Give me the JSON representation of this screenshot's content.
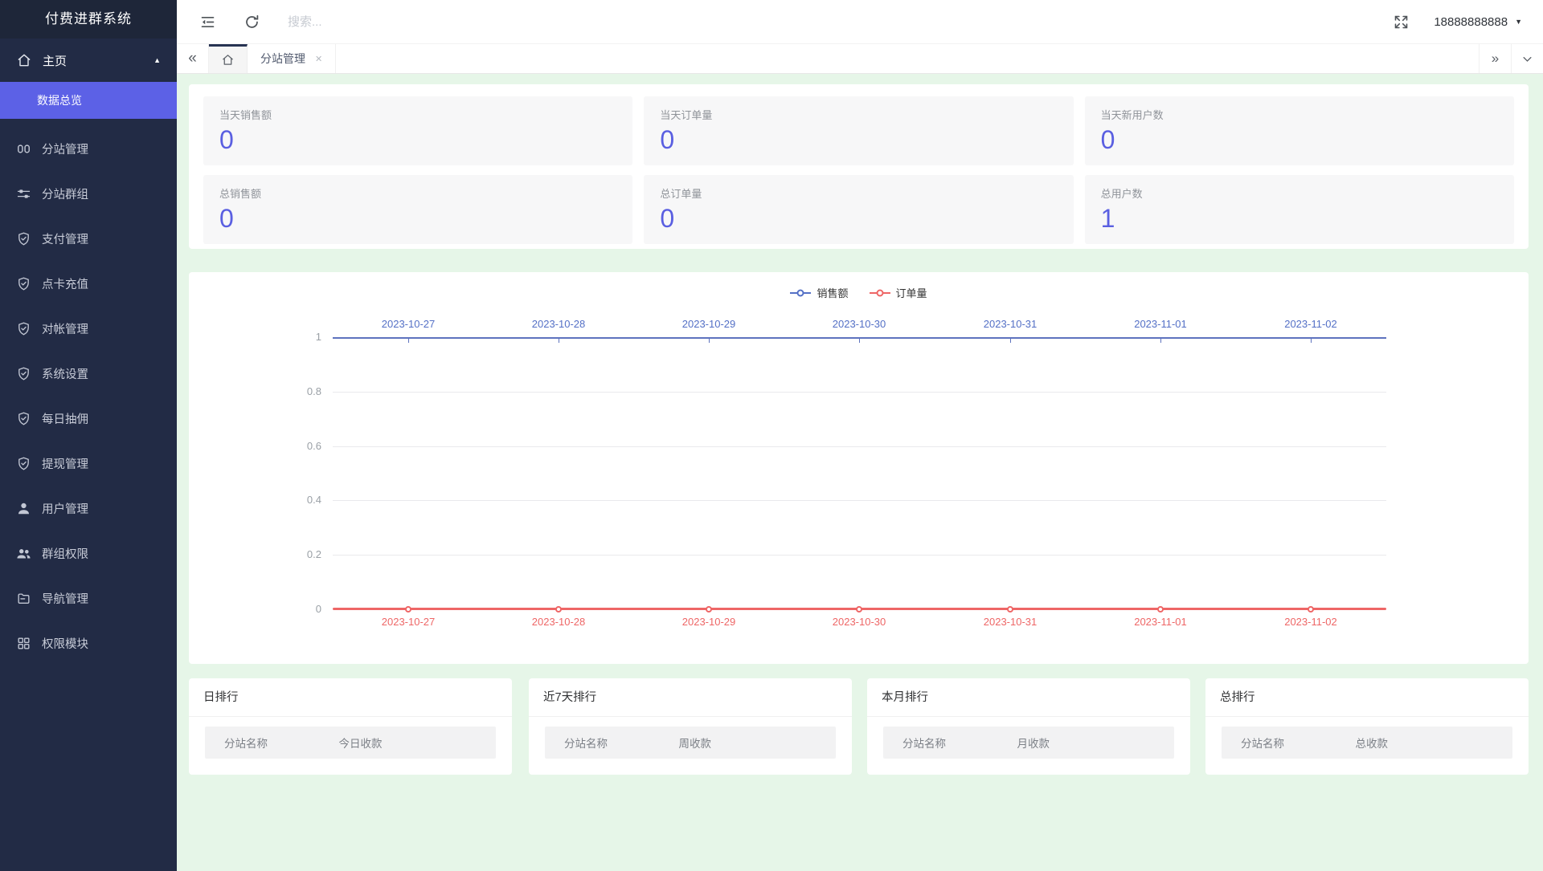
{
  "app": {
    "title": "付费进群系统"
  },
  "topbar": {
    "search_placeholder": "搜索...",
    "username": "18888888888"
  },
  "tabs": {
    "page_tab": "分站管理"
  },
  "sidebar": {
    "home": {
      "label": "主页"
    },
    "active_item": {
      "label": "数据总览"
    },
    "items": [
      {
        "label": "分站管理",
        "icon": "columns-icon"
      },
      {
        "label": "分站群组",
        "icon": "sliders-icon"
      },
      {
        "label": "支付管理",
        "icon": "shield-check-icon"
      },
      {
        "label": "点卡充值",
        "icon": "shield-check-icon"
      },
      {
        "label": "对帐管理",
        "icon": "shield-check-icon"
      },
      {
        "label": "系统设置",
        "icon": "shield-check-icon"
      },
      {
        "label": "每日抽佣",
        "icon": "shield-check-icon"
      },
      {
        "label": "提现管理",
        "icon": "shield-check-icon"
      },
      {
        "label": "用户管理",
        "icon": "user-icon"
      },
      {
        "label": "群组权限",
        "icon": "users-icon"
      },
      {
        "label": "导航管理",
        "icon": "navigation-icon"
      },
      {
        "label": "权限模块",
        "icon": "modules-icon"
      }
    ]
  },
  "stats": {
    "cards": [
      {
        "label": "当天销售额",
        "value": "0"
      },
      {
        "label": "当天订单量",
        "value": "0"
      },
      {
        "label": "当天新用户数",
        "value": "0"
      },
      {
        "label": "总销售额",
        "value": "0"
      },
      {
        "label": "总订单量",
        "value": "0"
      },
      {
        "label": "总用户数",
        "value": "1"
      }
    ]
  },
  "chart_data": {
    "type": "line",
    "categories": [
      "2023-10-27",
      "2023-10-28",
      "2023-10-29",
      "2023-10-30",
      "2023-10-31",
      "2023-11-01",
      "2023-11-02"
    ],
    "series": [
      {
        "name": "销售额",
        "values": [
          0,
          0,
          0,
          0,
          0,
          0,
          0
        ],
        "color": "#5470c6",
        "xaxis": "top"
      },
      {
        "name": "订单量",
        "values": [
          0,
          0,
          0,
          0,
          0,
          0,
          0
        ],
        "color": "#ee6666",
        "xaxis": "bottom"
      }
    ],
    "ylim": [
      0,
      1
    ],
    "yticks": [
      1,
      0.8,
      0.6,
      0.4,
      0.2,
      0
    ],
    "ytick_labels": [
      "1",
      "0.8",
      "0.6",
      "0.4",
      "0.2",
      "0"
    ],
    "legend_position": "top-center",
    "grid": true,
    "xlabel": "",
    "ylabel": "",
    "title": ""
  },
  "rankings": [
    {
      "title": "日排行",
      "col1": "分站名称",
      "col2": "今日收款"
    },
    {
      "title": "近7天排行",
      "col1": "分站名称",
      "col2": "周收款"
    },
    {
      "title": "本月排行",
      "col1": "分站名称",
      "col2": "月收款"
    },
    {
      "title": "总排行",
      "col1": "分站名称",
      "col2": "总收款"
    }
  ],
  "colors": {
    "sidebar_bg": "#222b45",
    "active_menu": "#5c61e6",
    "stat_number": "#5a5fe1",
    "series_blue": "#5470c6",
    "series_red": "#ee6666",
    "page_bg": "#e6f6e8"
  }
}
